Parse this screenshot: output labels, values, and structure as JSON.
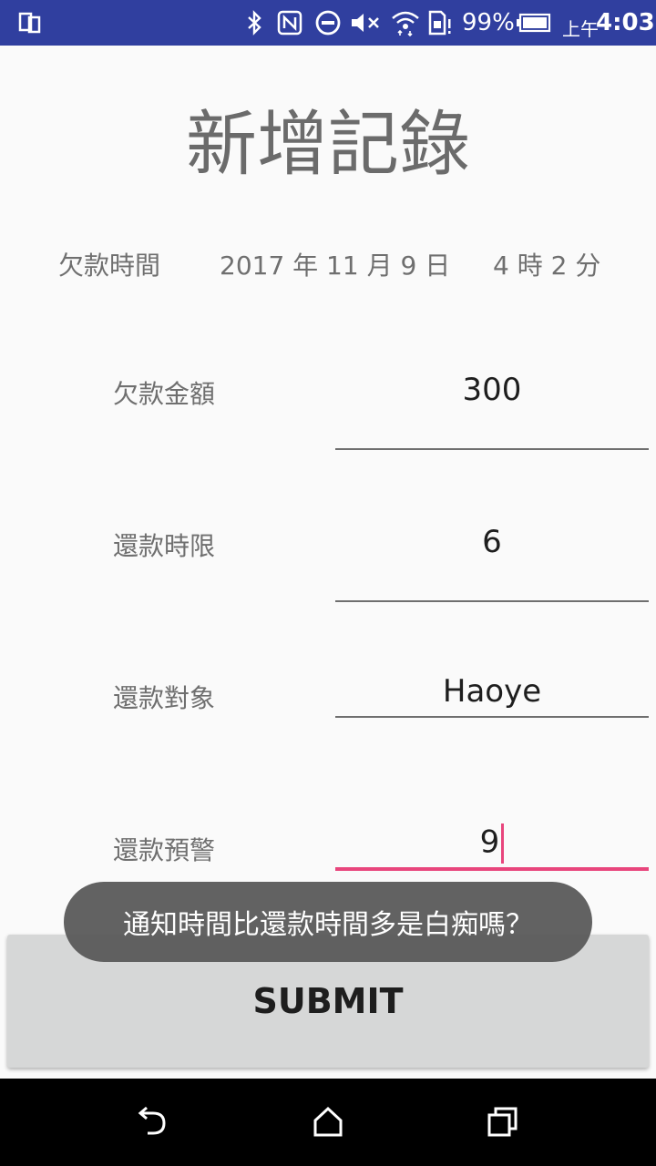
{
  "status_bar": {
    "battery_percent": "99%",
    "am_pm": "上午",
    "time": "4:03",
    "icons": [
      "screen-mirror-icon",
      "bluetooth-icon",
      "nfc-icon",
      "do-not-disturb-icon",
      "mute-icon",
      "wifi-icon",
      "sim-alert-icon",
      "battery-icon"
    ]
  },
  "page_title": "新增記錄",
  "debt_time": {
    "label": "欠款時間",
    "date": "2017 年 11 月 9 日",
    "time": "4 時 2 分"
  },
  "form": {
    "amount": {
      "label": "欠款金額",
      "value": "300"
    },
    "deadline": {
      "label": "還款時限",
      "value": "6"
    },
    "target": {
      "label": "還款對象",
      "value": "Haoye"
    },
    "warning": {
      "label": "還款預警",
      "value": "9"
    }
  },
  "submit_label": "SUBMIT",
  "toast_message": "通知時間比還款時間多是白痴嗎？",
  "colors": {
    "status_bar": "#303f9f",
    "accent": "#e8457c",
    "button": "#d6d7d7"
  }
}
